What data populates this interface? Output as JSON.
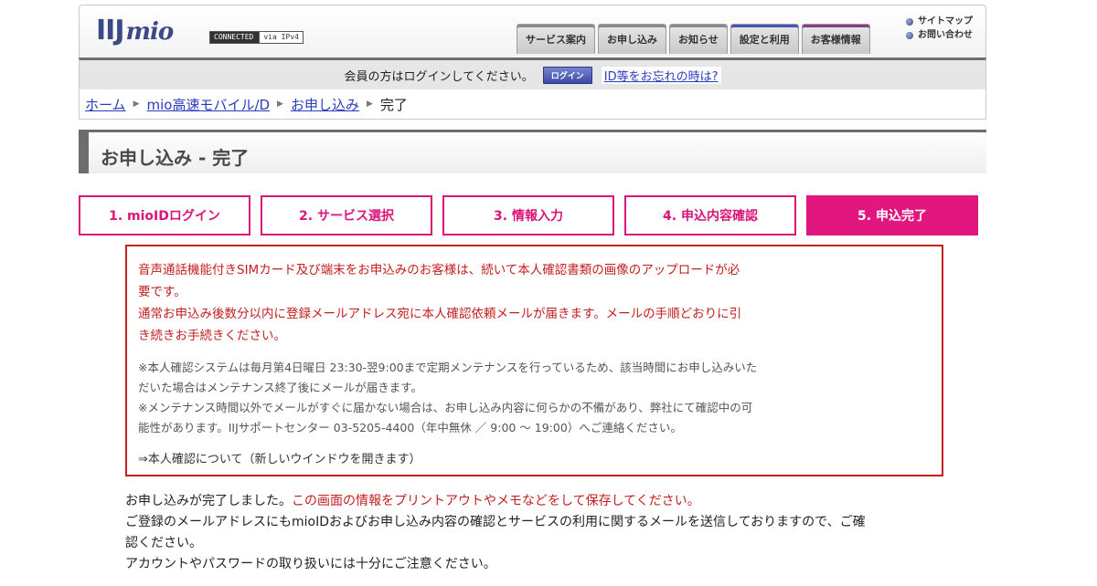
{
  "header": {
    "logo": "IIJ",
    "logo_sub": "mio",
    "connected": "CONNECTED",
    "via": "via IPv4",
    "tabs": [
      "サービス案内",
      "お申し込み",
      "お知らせ",
      "設定と利用",
      "お客様情報"
    ],
    "sitemap": "サイトマップ",
    "contact": "お問い合わせ"
  },
  "login": {
    "message": "会員の方はログインしてください。",
    "button": "ログイン",
    "forgot": "ID等をお忘れの時は?"
  },
  "breadcrumb": {
    "home": "ホーム",
    "service": "mio高速モバイル/D",
    "apply": "お申し込み",
    "current": "完了"
  },
  "page_title": "お申し込み - 完了",
  "steps": [
    "1. mioIDログイン",
    "2. サービス選択",
    "3. 情報入力",
    "4. 申込内容確認",
    "5. 申込完了"
  ],
  "notice": {
    "line1": "音声通話機能付きSIMカード及び端末をお申込みのお客様は、続いて本人確認書類の画像のアップロードが必",
    "line2": "要です。",
    "line3": "通常お申込み後数分以内に登録メールアドレス宛に本人確認依頼メールが届きます。メールの手順どおりに引",
    "line4": "き続きお手続きください。",
    "note1a": "※本人確認システムは毎月第4日曜日 23:30-翌9:00まで定期メンテナンスを行っているため、該当時間にお申し込みいた",
    "note1b": "だいた場合はメンテナンス終了後にメールが届きます。",
    "note2a": "※メンテナンス時間以外でメールがすぐに届かない場合は、お申し込み内容に何らかの不備があり、弊社にて確認中の可",
    "note2b": "能性があります。IIJサポートセンター 03-5205-4400（年中無休 ／ 9:00 〜 19:00）へご連絡ください。",
    "link": "⇒本人確認について（新しいウインドウを開きます）"
  },
  "body": {
    "done": "お申し込みが完了しました。",
    "save": "この画面の情報をプリントアウトやメモなどをして保存してください。",
    "mail1": "ご登録のメールアドレスにもmioIDおよびお申し込み内容の確認とサービスの利用に関するメールを送信しておりますので、ご確",
    "mail2": "認ください。",
    "caution": "アカウントやパスワードの取り扱いには十分にご注意ください。"
  }
}
